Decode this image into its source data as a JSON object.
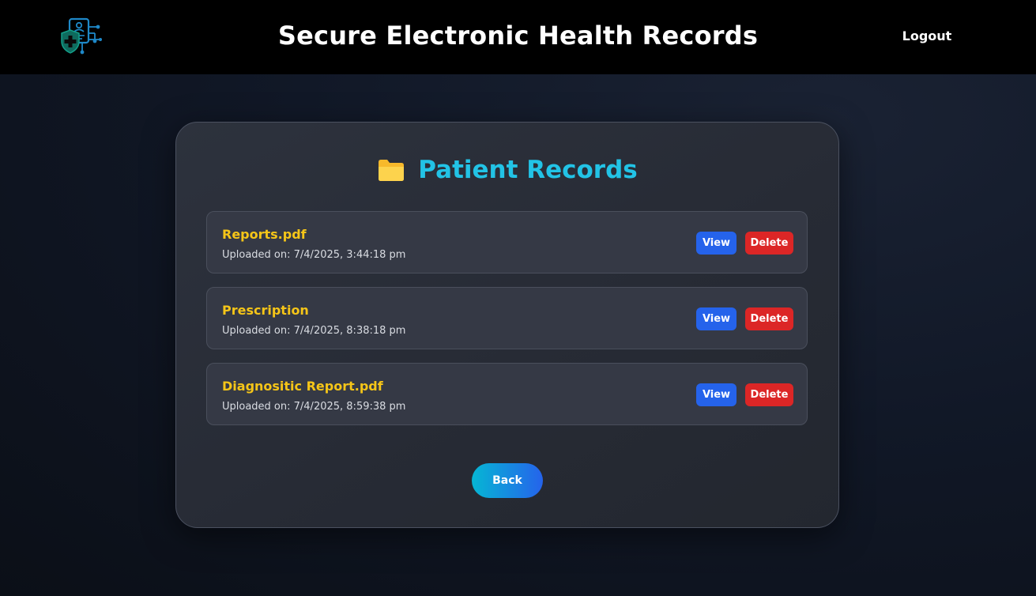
{
  "header": {
    "title": "Secure Electronic Health Records",
    "logout_label": "Logout"
  },
  "card": {
    "title": "Patient Records",
    "title_icon": "folder-icon",
    "records": [
      {
        "name": "Reports.pdf",
        "uploaded": "Uploaded on: 7/4/2025, 3:44:18 pm",
        "view_label": "View",
        "delete_label": "Delete"
      },
      {
        "name": "Prescription",
        "uploaded": "Uploaded on: 7/4/2025, 8:38:18 pm",
        "view_label": "View",
        "delete_label": "Delete"
      },
      {
        "name": "Diagnositic Report.pdf",
        "uploaded": "Uploaded on: 7/4/2025, 8:59:38 pm",
        "view_label": "View",
        "delete_label": "Delete"
      }
    ],
    "back_label": "Back"
  },
  "colors": {
    "accent_cyan": "#22c3e6",
    "record_name": "#f5c518",
    "view_button": "#2563eb",
    "delete_button": "#dc2626"
  }
}
